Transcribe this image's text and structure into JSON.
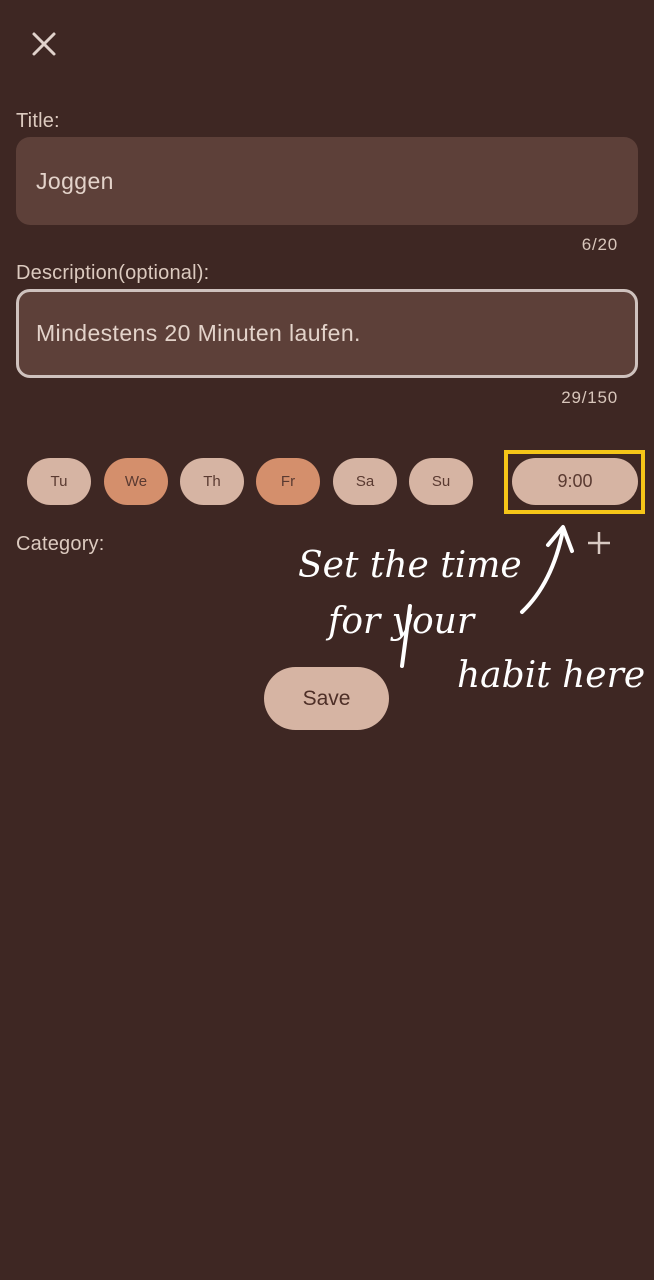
{
  "dialog": {
    "close_icon": "close-icon"
  },
  "title": {
    "label": "Title:",
    "value": "Joggen",
    "counter": "6/20"
  },
  "description": {
    "label": "Description(optional):",
    "value": "Mindestens 20 Minuten laufen.",
    "counter": "29/150"
  },
  "days": [
    {
      "label": "Tu",
      "selected": false
    },
    {
      "label": "We",
      "selected": true
    },
    {
      "label": "Th",
      "selected": false
    },
    {
      "label": "Fr",
      "selected": true
    },
    {
      "label": "Sa",
      "selected": false
    },
    {
      "label": "Su",
      "selected": false
    }
  ],
  "time": {
    "value": "9:00"
  },
  "category": {
    "label": "Category:",
    "add_icon": "plus-icon"
  },
  "save_label": "Save",
  "annotation": {
    "line1": "Set the time",
    "line2": "for your",
    "line3": "habit here"
  },
  "colors": {
    "background": "#3e2723",
    "field": "#5d4039",
    "chip": "#d6b4a3",
    "chip_selected": "#d48f6c",
    "highlight": "#f5c518"
  }
}
